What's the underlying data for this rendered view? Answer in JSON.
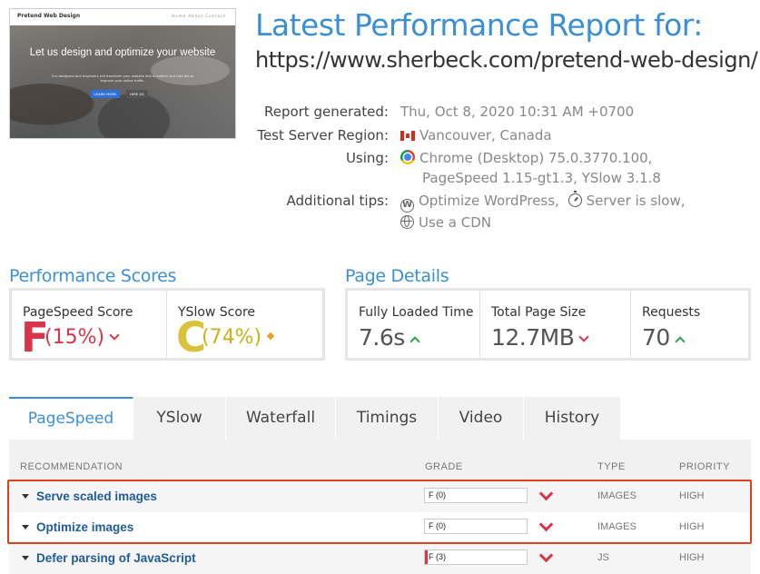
{
  "thumbnail": {
    "brand": "Pretend Web Design",
    "nav_links": "Home  About  Contact",
    "headline": "Let us design and optimize your website",
    "subtext": "Our designers and engineers will transform your website into a modern and fast site to improve your online traffic.",
    "primary_button": "LEARN MORE",
    "secondary_button": "HIRE US"
  },
  "header": {
    "title": "Latest Performance Report for:",
    "url": "https://www.sherbeck.com/pretend-web-design/"
  },
  "info": {
    "report_generated_label": "Report generated:",
    "report_generated_value": "Thu, Oct 8, 2020 10:31 AM +0700",
    "region_label": "Test Server Region:",
    "region_value": "Vancouver, Canada",
    "using_label": "Using:",
    "using_line1": "Chrome (Desktop) 75.0.3770.100,",
    "using_line2": "PageSpeed 1.15-gt1.3, YSlow 3.1.8",
    "tips_label": "Additional tips:",
    "tip_wordpress": "Optimize WordPress,",
    "tip_server": "Server is slow,",
    "tip_cdn": "Use a CDN"
  },
  "performance_scores": {
    "heading": "Performance Scores",
    "pagespeed_label": "PageSpeed Score",
    "pagespeed_grade": "F",
    "pagespeed_pct": "(15%)",
    "pagespeed_color": "#d9344a",
    "yslow_label": "YSlow Score",
    "yslow_grade": "C",
    "yslow_pct": "(74%)",
    "yslow_color": "#d8c43a",
    "yslow_pct_color": "#c9b21a"
  },
  "page_details": {
    "heading": "Page Details",
    "loaded_label": "Fully Loaded Time",
    "loaded_value": "7.6s",
    "size_label": "Total Page Size",
    "size_value": "12.7MB",
    "requests_label": "Requests",
    "requests_value": "70"
  },
  "tabs": [
    {
      "label": "PageSpeed",
      "active": true
    },
    {
      "label": "YSlow",
      "active": false
    },
    {
      "label": "Waterfall",
      "active": false
    },
    {
      "label": "Timings",
      "active": false
    },
    {
      "label": "Video",
      "active": false
    },
    {
      "label": "History",
      "active": false
    }
  ],
  "table": {
    "headers": {
      "recommendation": "RECOMMENDATION",
      "grade": "GRADE",
      "type": "TYPE",
      "priority": "PRIORITY"
    },
    "rows": [
      {
        "recommendation": "Serve scaled images",
        "grade": "F (0)",
        "score": 0,
        "type": "IMAGES",
        "priority": "HIGH"
      },
      {
        "recommendation": "Optimize images",
        "grade": "F (0)",
        "score": 0,
        "type": "IMAGES",
        "priority": "HIGH"
      },
      {
        "recommendation": "Defer parsing of JavaScript",
        "grade": "F (3)",
        "score": 3,
        "type": "JS",
        "priority": "HIGH"
      }
    ]
  },
  "colors": {
    "accent": "#3b8fd6",
    "bad": "#d9344a",
    "good": "#2aa14a",
    "highlight": "#e2401c"
  }
}
